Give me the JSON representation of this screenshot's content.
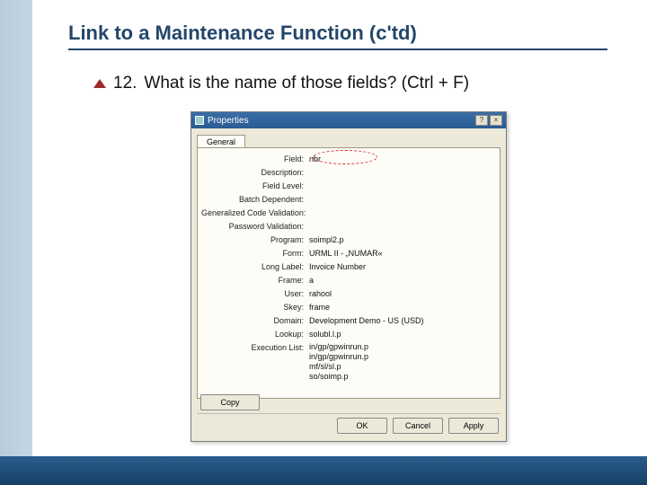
{
  "slide": {
    "title": "Link to a Maintenance Function (c'td)",
    "bullet_number": "12.",
    "bullet_text": "What is the name of those fields? (Ctrl + F)"
  },
  "dialog": {
    "title": "Properties",
    "tab": "General",
    "rows": [
      {
        "label": "Field:",
        "value": "nbr"
      },
      {
        "label": "Description:",
        "value": ""
      },
      {
        "label": "Field Level:",
        "value": ""
      },
      {
        "label": "Batch Dependent:",
        "value": ""
      },
      {
        "label": "Generalized Code Validation:",
        "value": ""
      },
      {
        "label": "Password Validation:",
        "value": ""
      },
      {
        "label": "Program:",
        "value": "soimpl2.p"
      },
      {
        "label": "Form:",
        "value": "URML II - „NUMAR«"
      },
      {
        "label": "Long Label:",
        "value": "Invoice Number"
      },
      {
        "label": "Frame:",
        "value": "a"
      },
      {
        "label": "User:",
        "value": "rahool"
      },
      {
        "label": "Skey:",
        "value": "frame"
      },
      {
        "label": "Domain:",
        "value": "Development Demo - US (USD)"
      },
      {
        "label": "Lookup:",
        "value": "solubl.l.p"
      },
      {
        "label": "Execution List:",
        "value": "in/gp/gpwinrun.p\nin/gp/gpwinrun.p\nmf/sl/sl.p\nso/soimp.p"
      }
    ],
    "buttons": {
      "copy": "Copy",
      "ok": "OK",
      "cancel": "Cancel",
      "apply": "Apply"
    }
  }
}
